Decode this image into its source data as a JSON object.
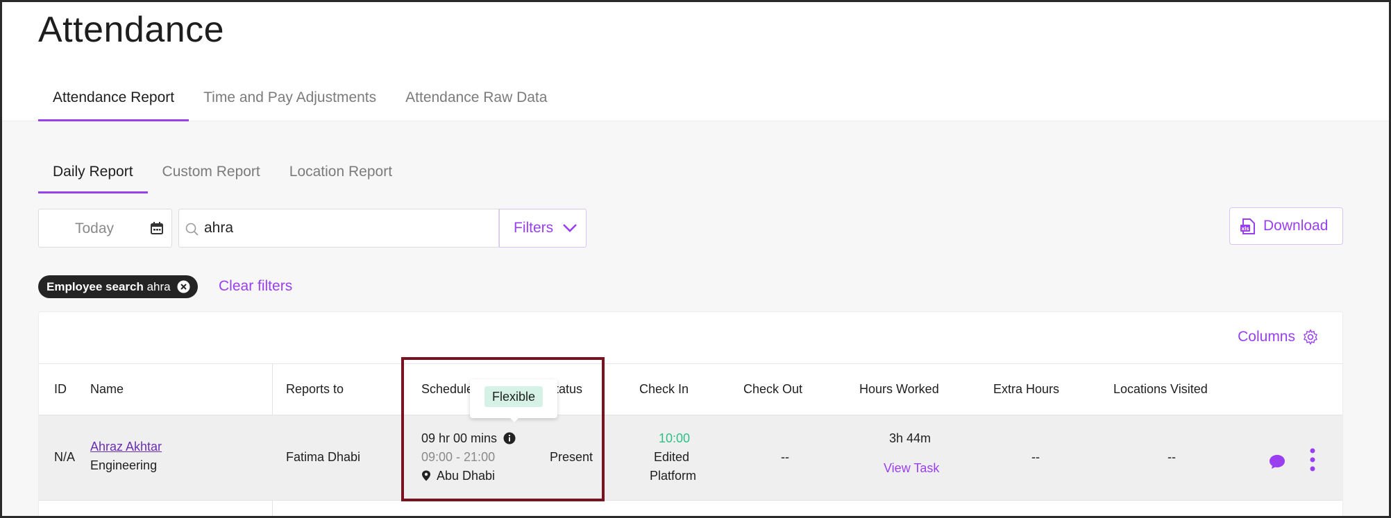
{
  "page": {
    "title": "Attendance"
  },
  "main_tabs": [
    {
      "label": "Attendance Report",
      "active": true
    },
    {
      "label": "Time and Pay Adjustments",
      "active": false
    },
    {
      "label": "Attendance Raw Data",
      "active": false
    }
  ],
  "sub_tabs": [
    {
      "label": "Daily Report",
      "active": true
    },
    {
      "label": "Custom Report",
      "active": false
    },
    {
      "label": "Location Report",
      "active": false
    }
  ],
  "toolbar": {
    "date_value": "Today",
    "date_icon": "calendar-icon",
    "search_icon": "search-icon",
    "search_value": "ahra",
    "filters_label": "Filters",
    "filters_icon": "chevron-down-icon",
    "download_label": "Download",
    "download_icon": "file-download-icon"
  },
  "active_filters": {
    "chip_label": "Employee search",
    "chip_value": "ahra",
    "chip_remove_icon": "close-circle-icon",
    "clear_label": "Clear filters"
  },
  "table": {
    "columns_label": "Columns",
    "columns_icon": "gear-icon",
    "headers": {
      "id": "ID",
      "name": "Name",
      "reports_to": "Reports to",
      "schedule": "Schedule",
      "status": "Status",
      "check_in": "Check In",
      "check_out": "Check Out",
      "hours_worked": "Hours Worked",
      "extra_hours": "Extra Hours",
      "locations_visited": "Locations Visited"
    },
    "rows": [
      {
        "id": "N/A",
        "name": "Ahraz Akhtar",
        "department": "Engineering",
        "reports_to": "Fatima Dhabi",
        "schedule_duration": "09 hr 00 mins",
        "schedule_hours": "09:00 - 21:00",
        "schedule_location": "Abu Dhabi",
        "status": "Present",
        "check_in_time": "10:00",
        "check_in_note_1": "Edited",
        "check_in_note_2": "Platform",
        "check_out": "--",
        "hours_worked": "3h 44m",
        "view_task_label": "View Task",
        "extra_hours": "--",
        "locations_visited": "--",
        "comment_icon": "chat-bubble-icon",
        "menu_icon": "kebab-menu-icon"
      }
    ]
  },
  "tooltip": {
    "label": "Flexible"
  },
  "colors": {
    "accent": "#9a3ff0",
    "highlight_border": "#7a1220",
    "check_in_green": "#2fbf86",
    "tooltip_green": "#d6f2e6"
  }
}
